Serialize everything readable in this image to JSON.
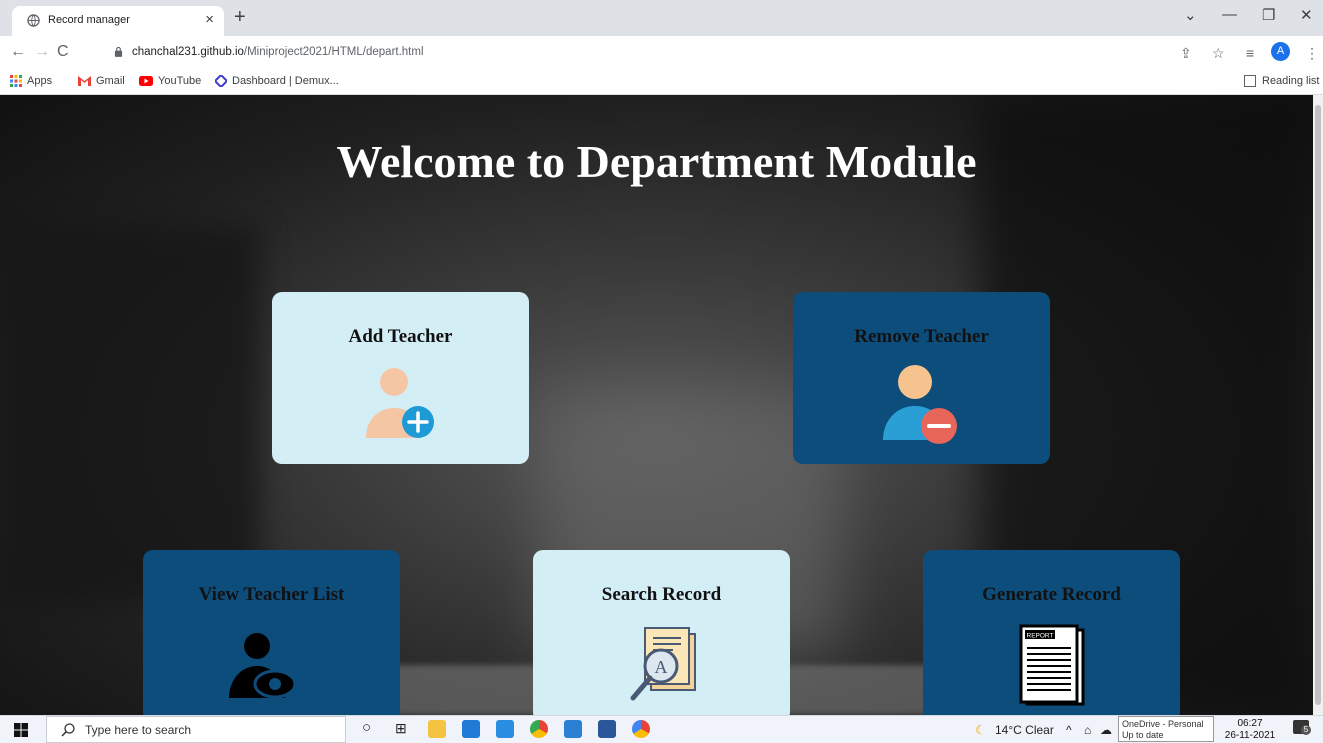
{
  "browser": {
    "tab_title": "Record manager",
    "tab_close": "×",
    "new_tab": "+",
    "url_host": "chanchal231.github.io",
    "url_path": "/Miniproject2021/HTML/depart.html",
    "profile_initial": "A",
    "reading_list": "Reading list"
  },
  "bookmarks": [
    {
      "label": "Apps",
      "icon": "apps-grid-icon"
    },
    {
      "label": "Gmail",
      "icon": "gmail-icon"
    },
    {
      "label": "YouTube",
      "icon": "youtube-icon"
    },
    {
      "label": "Dashboard | Demux...",
      "icon": "demux-icon"
    }
  ],
  "page": {
    "heading": "Welcome to Department Module",
    "cards": [
      {
        "label": "Add Teacher",
        "icon": "add-user-icon",
        "style": "light"
      },
      {
        "label": "Remove Teacher",
        "icon": "remove-user-icon",
        "style": "dark"
      },
      {
        "label": "View Teacher List",
        "icon": "view-user-icon",
        "style": "dark"
      },
      {
        "label": "Search Record",
        "icon": "search-document-icon",
        "style": "light"
      },
      {
        "label": "Generate Record",
        "icon": "report-icon",
        "style": "dark"
      }
    ]
  },
  "taskbar": {
    "search_placeholder": "Type here to search",
    "weather": "14°C Clear",
    "onedrive_line1": "OneDrive - Personal",
    "onedrive_line2": "Up to date",
    "time": "06:27",
    "date": "26-11-2021",
    "notification_count": "5"
  },
  "colors": {
    "card_light": "#d4eef6",
    "card_dark": "#0d4d7c",
    "accent_blue": "#1a73e8"
  }
}
